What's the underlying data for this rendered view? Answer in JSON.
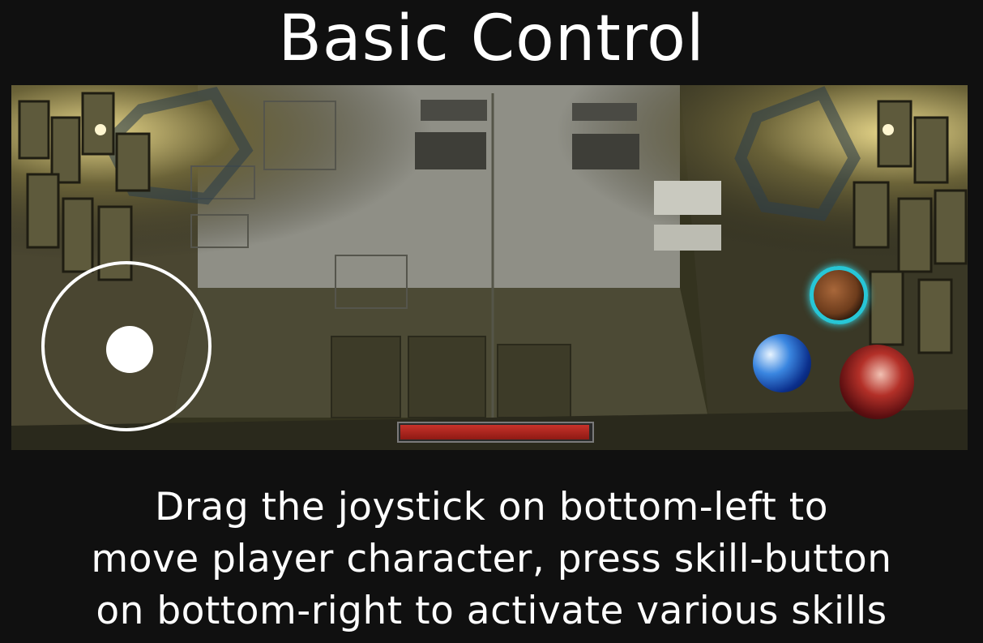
{
  "title": "Basic Control",
  "caption": {
    "line1": "Drag the joystick on bottom-left to",
    "line2": "move player character, press skill-button",
    "line3": "on bottom-right to activate various skills"
  },
  "hud": {
    "health_fraction": 0.99,
    "health_color": "#b52a22",
    "skill_buttons": [
      {
        "name": "shield-skill",
        "accent": "#27c6d6"
      },
      {
        "name": "dash-skill",
        "accent": "#3a86e0"
      },
      {
        "name": "slash-skill",
        "accent": "#b33028"
      }
    ]
  }
}
